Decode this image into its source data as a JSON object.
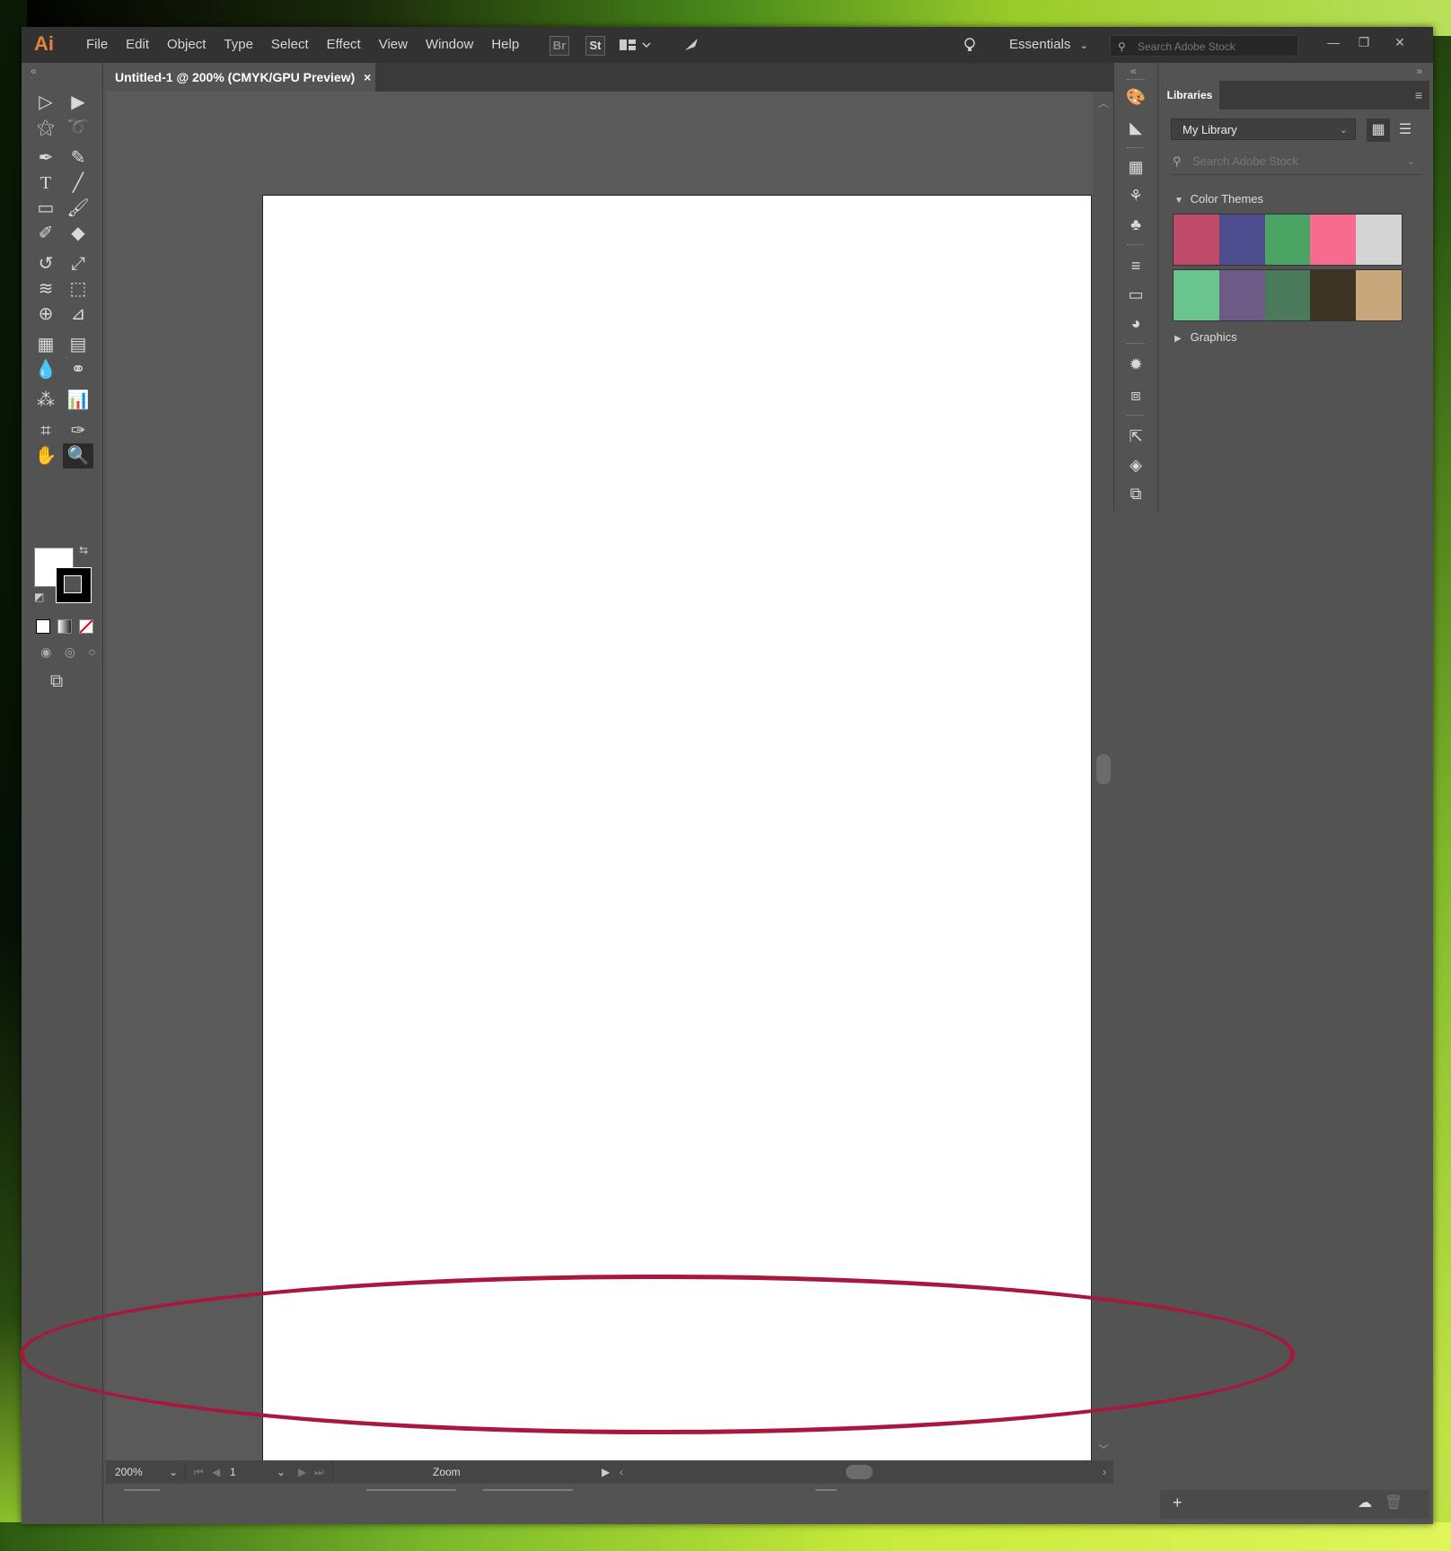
{
  "app": {
    "logo": "Ai"
  },
  "menu": {
    "items": [
      "File",
      "Edit",
      "Object",
      "Type",
      "Select",
      "Effect",
      "View",
      "Window",
      "Help"
    ]
  },
  "topbar": {
    "bridge_label": "Br",
    "stock_label": "St",
    "workspace": "Essentials",
    "search_placeholder": "Search Adobe Stock"
  },
  "document": {
    "tab_title": "Untitled-1 @ 200% (CMYK/GPU Preview)",
    "close_glyph": "×"
  },
  "statusbar": {
    "zoom": "200%",
    "artboard_number": "1",
    "tool_name": "Zoom"
  },
  "libraries": {
    "tab_label": "Libraries",
    "library_name": "My Library",
    "search_placeholder": "Search Adobe Stock",
    "color_themes_label": "Color Themes",
    "graphics_label": "Graphics",
    "themes": [
      [
        "#c04a6a",
        "#4e4e8e",
        "#4aa564",
        "#f86a8e",
        "#d4d4d4"
      ],
      [
        "#6ac48e",
        "#6e5a86",
        "#4a7a5a",
        "#3e3424",
        "#c8a87a"
      ]
    ]
  },
  "colors": {
    "annotation": "#a8183c",
    "accent_logo": "#e6823c"
  }
}
